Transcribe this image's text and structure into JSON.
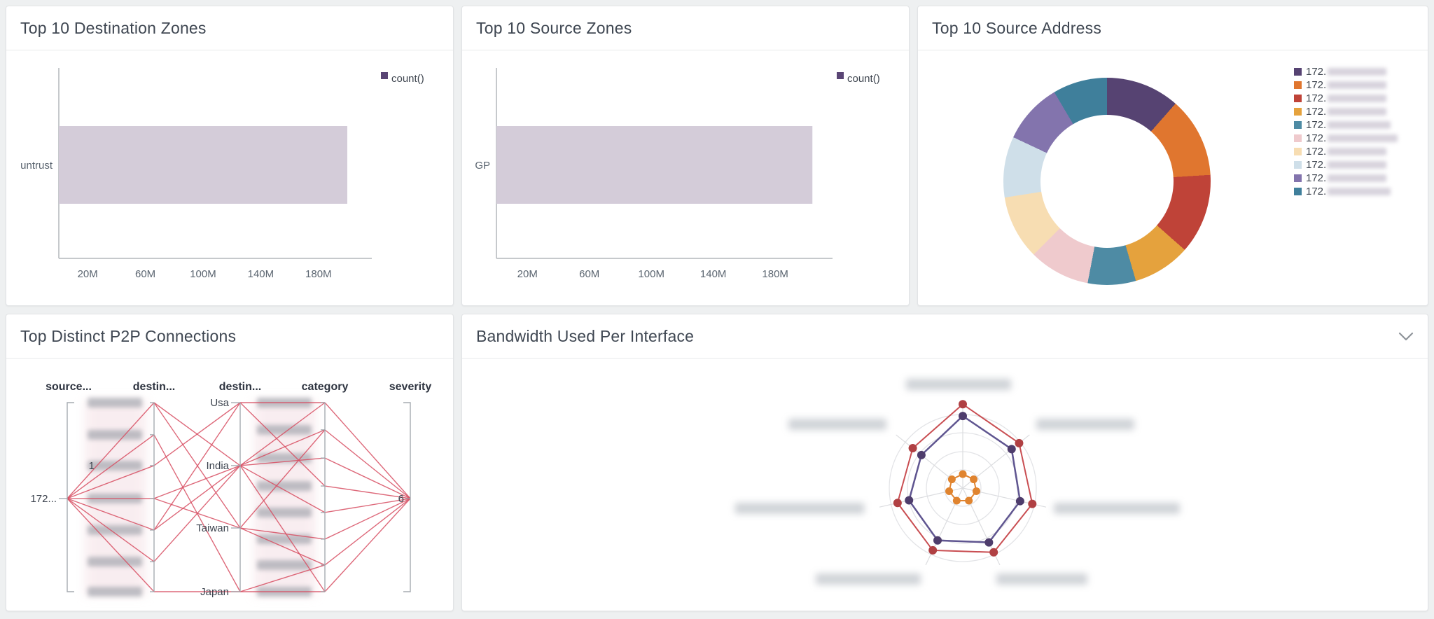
{
  "page": {
    "background_color": "#eef0f1"
  },
  "panels": [
    {
      "id": "dest_zones",
      "title": "Top 10 Destination Zones"
    },
    {
      "id": "source_zones",
      "title": "Top 10 Source Zones"
    },
    {
      "id": "source_address",
      "title": "Top 10 Source Address"
    },
    {
      "id": "p2p",
      "title": "Top Distinct P2P Connections"
    },
    {
      "id": "bandwidth",
      "title": "Bandwidth Used Per Interface",
      "header_icon": "chevron-down-icon"
    }
  ],
  "chart_data": [
    {
      "id": "dest_zones",
      "type": "bar",
      "orientation": "horizontal",
      "title": "Top 10 Destination Zones",
      "categories": [
        "untrust"
      ],
      "series": [
        {
          "name": "count()",
          "values": [
            200000000
          ]
        }
      ],
      "x_ticks": [
        {
          "value": 20000000,
          "label": "20M"
        },
        {
          "value": 60000000,
          "label": "60M"
        },
        {
          "value": 100000000,
          "label": "100M"
        },
        {
          "value": 140000000,
          "label": "140M"
        },
        {
          "value": 180000000,
          "label": "180M"
        }
      ],
      "xlim": [
        0,
        217000000
      ],
      "grid": false,
      "legend_position": "top-right",
      "bar_color": "#d4ccd9",
      "legend_swatch_color": "#5a4575"
    },
    {
      "id": "source_zones",
      "type": "bar",
      "orientation": "horizontal",
      "title": "Top 10 Source Zones",
      "categories": [
        "GP"
      ],
      "series": [
        {
          "name": "count()",
          "values": [
            204000000
          ]
        }
      ],
      "x_ticks": [
        {
          "value": 20000000,
          "label": "20M"
        },
        {
          "value": 60000000,
          "label": "60M"
        },
        {
          "value": 100000000,
          "label": "100M"
        },
        {
          "value": 140000000,
          "label": "140M"
        },
        {
          "value": 180000000,
          "label": "180M"
        }
      ],
      "xlim": [
        0,
        217000000
      ],
      "grid": false,
      "legend_position": "top-right",
      "bar_color": "#d4ccd9",
      "legend_swatch_color": "#5a4575"
    },
    {
      "id": "source_address",
      "type": "pie",
      "donut": true,
      "title": "Top 10 Source Address",
      "legend_position": "right",
      "slices": [
        {
          "label": "172.",
          "masked": true,
          "pct": 11.5,
          "color": "#564372"
        },
        {
          "label": "172.",
          "masked": true,
          "pct": 12.5,
          "color": "#e0762f"
        },
        {
          "label": "172.",
          "masked": true,
          "pct": 12.5,
          "color": "#bf4338"
        },
        {
          "label": "172.",
          "masked": true,
          "pct": 9.0,
          "color": "#e5a23d"
        },
        {
          "label": "172.",
          "masked": true,
          "pct": 7.5,
          "color": "#4e8ba4"
        },
        {
          "label": "172.",
          "masked": true,
          "pct": 9.5,
          "color": "#efcacd"
        },
        {
          "label": "172.",
          "masked": true,
          "pct": 10.0,
          "color": "#f7ddb2"
        },
        {
          "label": "172.",
          "masked": true,
          "pct": 9.5,
          "color": "#cfdfe9"
        },
        {
          "label": "172.",
          "masked": true,
          "pct": 9.5,
          "color": "#8374ad"
        },
        {
          "label": "172.",
          "masked": true,
          "pct": 8.5,
          "color": "#3f7f9b"
        }
      ]
    },
    {
      "id": "p2p",
      "type": "parallel-coordinates",
      "title": "Top Distinct P2P Connections",
      "line_color": "#d84f63",
      "axis_headers": [
        "source...",
        "destin...",
        "destin...",
        "category",
        "severity"
      ],
      "axes": [
        {
          "name": "source",
          "style": "bracket",
          "nodes": [
            {
              "label": "172...",
              "masked": false,
              "f": 0.507
            }
          ]
        },
        {
          "name": "destination-1",
          "style": "line",
          "nodes": [
            {
              "label": "",
              "masked": true,
              "f": 0
            },
            {
              "label": "",
              "masked": true,
              "f": 0.17
            },
            {
              "label": "1",
              "masked": true,
              "f": 0.333
            },
            {
              "label": "",
              "masked": true,
              "f": 0.507
            },
            {
              "label": "",
              "masked": true,
              "f": 0.674
            },
            {
              "label": "",
              "masked": true,
              "f": 0.841
            },
            {
              "label": "",
              "masked": true,
              "f": 1
            }
          ]
        },
        {
          "name": "destination-country",
          "style": "line",
          "nodes": [
            {
              "label": "Usa",
              "masked": false,
              "f": 0
            },
            {
              "label": "India",
              "masked": false,
              "f": 0.333
            },
            {
              "label": "Taiwan",
              "masked": false,
              "f": 0.663
            },
            {
              "label": "Japan",
              "masked": false,
              "f": 1
            }
          ]
        },
        {
          "name": "category",
          "style": "line",
          "nodes": [
            {
              "label": "",
              "masked": true,
              "f": 0
            },
            {
              "label": "",
              "masked": true,
              "f": 0.144
            },
            {
              "label": "",
              "masked": true,
              "f": 0.293
            },
            {
              "label": "",
              "masked": true,
              "f": 0.441
            },
            {
              "label": "",
              "masked": true,
              "f": 0.581
            },
            {
              "label": "",
              "masked": true,
              "f": 0.722
            },
            {
              "label": "",
              "masked": true,
              "f": 0.859
            },
            {
              "label": "",
              "masked": true,
              "f": 1
            }
          ]
        },
        {
          "name": "severity",
          "style": "bracket",
          "nodes": [
            {
              "label": "6",
              "masked": false,
              "f": 0.507
            }
          ]
        }
      ],
      "links": {
        "source_to_destination1": [
          [
            0,
            0
          ],
          [
            0,
            1
          ],
          [
            0,
            2
          ],
          [
            0,
            3
          ],
          [
            0,
            4
          ],
          [
            0,
            5
          ],
          [
            0,
            6
          ]
        ],
        "destination1_to_country": [
          [
            0,
            1
          ],
          [
            0,
            2
          ],
          [
            1,
            3
          ],
          [
            2,
            0
          ],
          [
            3,
            1
          ],
          [
            3,
            2
          ],
          [
            4,
            0
          ],
          [
            4,
            1
          ],
          [
            5,
            1
          ],
          [
            6,
            3
          ]
        ],
        "country_to_category": [
          [
            0,
            0
          ],
          [
            0,
            3
          ],
          [
            1,
            0
          ],
          [
            1,
            1
          ],
          [
            1,
            2
          ],
          [
            1,
            4
          ],
          [
            1,
            7
          ],
          [
            2,
            1
          ],
          [
            2,
            5
          ],
          [
            2,
            6
          ],
          [
            3,
            6
          ],
          [
            3,
            7
          ]
        ],
        "category_to_severity": [
          [
            0,
            0
          ],
          [
            1,
            0
          ],
          [
            2,
            0
          ],
          [
            3,
            0
          ],
          [
            4,
            0
          ],
          [
            5,
            0
          ],
          [
            6,
            0
          ],
          [
            7,
            0
          ]
        ]
      }
    },
    {
      "id": "bandwidth",
      "type": "radar",
      "title": "Bandwidth Used Per Interface",
      "spokes": 7,
      "rings": 4,
      "spoke_labels_masked": true,
      "series": [
        {
          "name": "series-red",
          "color": "#c94e52",
          "dot_color": "#b04043",
          "values": [
            1.14,
            0.98,
            0.97,
            0.97,
            0.94,
            0.91,
            0.87
          ]
        },
        {
          "name": "series-purple",
          "color": "#5f5590",
          "dot_color": "#4e3d6c",
          "values": [
            0.98,
            0.85,
            0.8,
            0.82,
            0.79,
            0.75,
            0.72
          ]
        },
        {
          "name": "series-orange",
          "color": "#e08532",
          "dot_color": "#e0842f",
          "values": [
            0.19,
            0.19,
            0.19,
            0.19,
            0.19,
            0.19,
            0.19
          ]
        }
      ]
    }
  ]
}
